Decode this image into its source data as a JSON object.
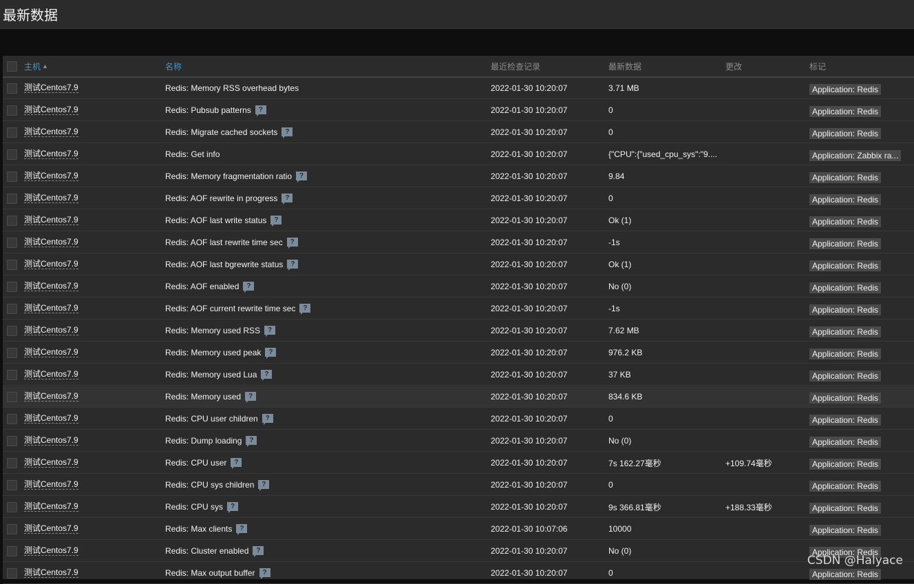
{
  "page": {
    "title": "最新数据"
  },
  "table": {
    "columns": {
      "host": "主机",
      "name": "名称",
      "last_check": "最近检查记录",
      "last_value": "最新数据",
      "change": "更改",
      "tags": "标记"
    },
    "rows": [
      {
        "host": "测试Centos7.9",
        "name": "Redis: Memory RSS overhead bytes",
        "hint": false,
        "time": "2022-01-30 10:20:07",
        "value": "3.71 MB",
        "change": "",
        "tag": "Application: Redis"
      },
      {
        "host": "测试Centos7.9",
        "name": "Redis: Pubsub patterns",
        "hint": true,
        "time": "2022-01-30 10:20:07",
        "value": "0",
        "change": "",
        "tag": "Application: Redis"
      },
      {
        "host": "测试Centos7.9",
        "name": "Redis: Migrate cached sockets",
        "hint": true,
        "time": "2022-01-30 10:20:07",
        "value": "0",
        "change": "",
        "tag": "Application: Redis"
      },
      {
        "host": "测试Centos7.9",
        "name": "Redis: Get info",
        "hint": false,
        "time": "2022-01-30 10:20:07",
        "value": "{\"CPU\":{\"used_cpu_sys\":\"9....",
        "change": "",
        "tag": "Application: Zabbix ra..."
      },
      {
        "host": "测试Centos7.9",
        "name": "Redis: Memory fragmentation ratio",
        "hint": true,
        "time": "2022-01-30 10:20:07",
        "value": "9.84",
        "change": "",
        "tag": "Application: Redis"
      },
      {
        "host": "测试Centos7.9",
        "name": "Redis: AOF rewrite in progress",
        "hint": true,
        "time": "2022-01-30 10:20:07",
        "value": "0",
        "change": "",
        "tag": "Application: Redis"
      },
      {
        "host": "测试Centos7.9",
        "name": "Redis: AOF last write status",
        "hint": true,
        "time": "2022-01-30 10:20:07",
        "value": "Ok (1)",
        "change": "",
        "tag": "Application: Redis"
      },
      {
        "host": "测试Centos7.9",
        "name": "Redis: AOF last rewrite time sec",
        "hint": true,
        "time": "2022-01-30 10:20:07",
        "value": "-1s",
        "change": "",
        "tag": "Application: Redis"
      },
      {
        "host": "测试Centos7.9",
        "name": "Redis: AOF last bgrewrite status",
        "hint": true,
        "time": "2022-01-30 10:20:07",
        "value": "Ok (1)",
        "change": "",
        "tag": "Application: Redis"
      },
      {
        "host": "测试Centos7.9",
        "name": "Redis: AOF enabled",
        "hint": true,
        "time": "2022-01-30 10:20:07",
        "value": "No (0)",
        "change": "",
        "tag": "Application: Redis"
      },
      {
        "host": "测试Centos7.9",
        "name": "Redis: AOF current rewrite time sec",
        "hint": true,
        "time": "2022-01-30 10:20:07",
        "value": "-1s",
        "change": "",
        "tag": "Application: Redis"
      },
      {
        "host": "测试Centos7.9",
        "name": "Redis: Memory used RSS",
        "hint": true,
        "time": "2022-01-30 10:20:07",
        "value": "7.62 MB",
        "change": "",
        "tag": "Application: Redis"
      },
      {
        "host": "测试Centos7.9",
        "name": "Redis: Memory used peak",
        "hint": true,
        "time": "2022-01-30 10:20:07",
        "value": "976.2 KB",
        "change": "",
        "tag": "Application: Redis"
      },
      {
        "host": "测试Centos7.9",
        "name": "Redis: Memory used Lua",
        "hint": true,
        "time": "2022-01-30 10:20:07",
        "value": "37 KB",
        "change": "",
        "tag": "Application: Redis"
      },
      {
        "host": "测试Centos7.9",
        "name": "Redis: Memory used",
        "hint": true,
        "time": "2022-01-30 10:20:07",
        "value": "834.6 KB",
        "change": "",
        "tag": "Application: Redis",
        "hover": true
      },
      {
        "host": "测试Centos7.9",
        "name": "Redis: CPU user children",
        "hint": true,
        "time": "2022-01-30 10:20:07",
        "value": "0",
        "change": "",
        "tag": "Application: Redis"
      },
      {
        "host": "测试Centos7.9",
        "name": "Redis: Dump loading",
        "hint": true,
        "time": "2022-01-30 10:20:07",
        "value": "No (0)",
        "change": "",
        "tag": "Application: Redis"
      },
      {
        "host": "测试Centos7.9",
        "name": "Redis: CPU user",
        "hint": true,
        "time": "2022-01-30 10:20:07",
        "value": "7s 162.27毫秒",
        "change": "+109.74毫秒",
        "tag": "Application: Redis"
      },
      {
        "host": "测试Centos7.9",
        "name": "Redis: CPU sys children",
        "hint": true,
        "time": "2022-01-30 10:20:07",
        "value": "0",
        "change": "",
        "tag": "Application: Redis"
      },
      {
        "host": "测试Centos7.9",
        "name": "Redis: CPU sys",
        "hint": true,
        "time": "2022-01-30 10:20:07",
        "value": "9s 366.81毫秒",
        "change": "+188.33毫秒",
        "tag": "Application: Redis"
      },
      {
        "host": "测试Centos7.9",
        "name": "Redis: Max clients",
        "hint": true,
        "time": "2022-01-30 10:07:06",
        "value": "10000",
        "change": "",
        "tag": "Application: Redis"
      },
      {
        "host": "测试Centos7.9",
        "name": "Redis: Cluster enabled",
        "hint": true,
        "time": "2022-01-30 10:20:07",
        "value": "No (0)",
        "change": "",
        "tag": "Application: Redis"
      },
      {
        "host": "测试Centos7.9",
        "name": "Redis: Max output buffer",
        "hint": true,
        "time": "2022-01-30 10:20:07",
        "value": "0",
        "change": "",
        "tag": "Application: Redis"
      }
    ]
  },
  "watermark": "CSDN @Halyace"
}
